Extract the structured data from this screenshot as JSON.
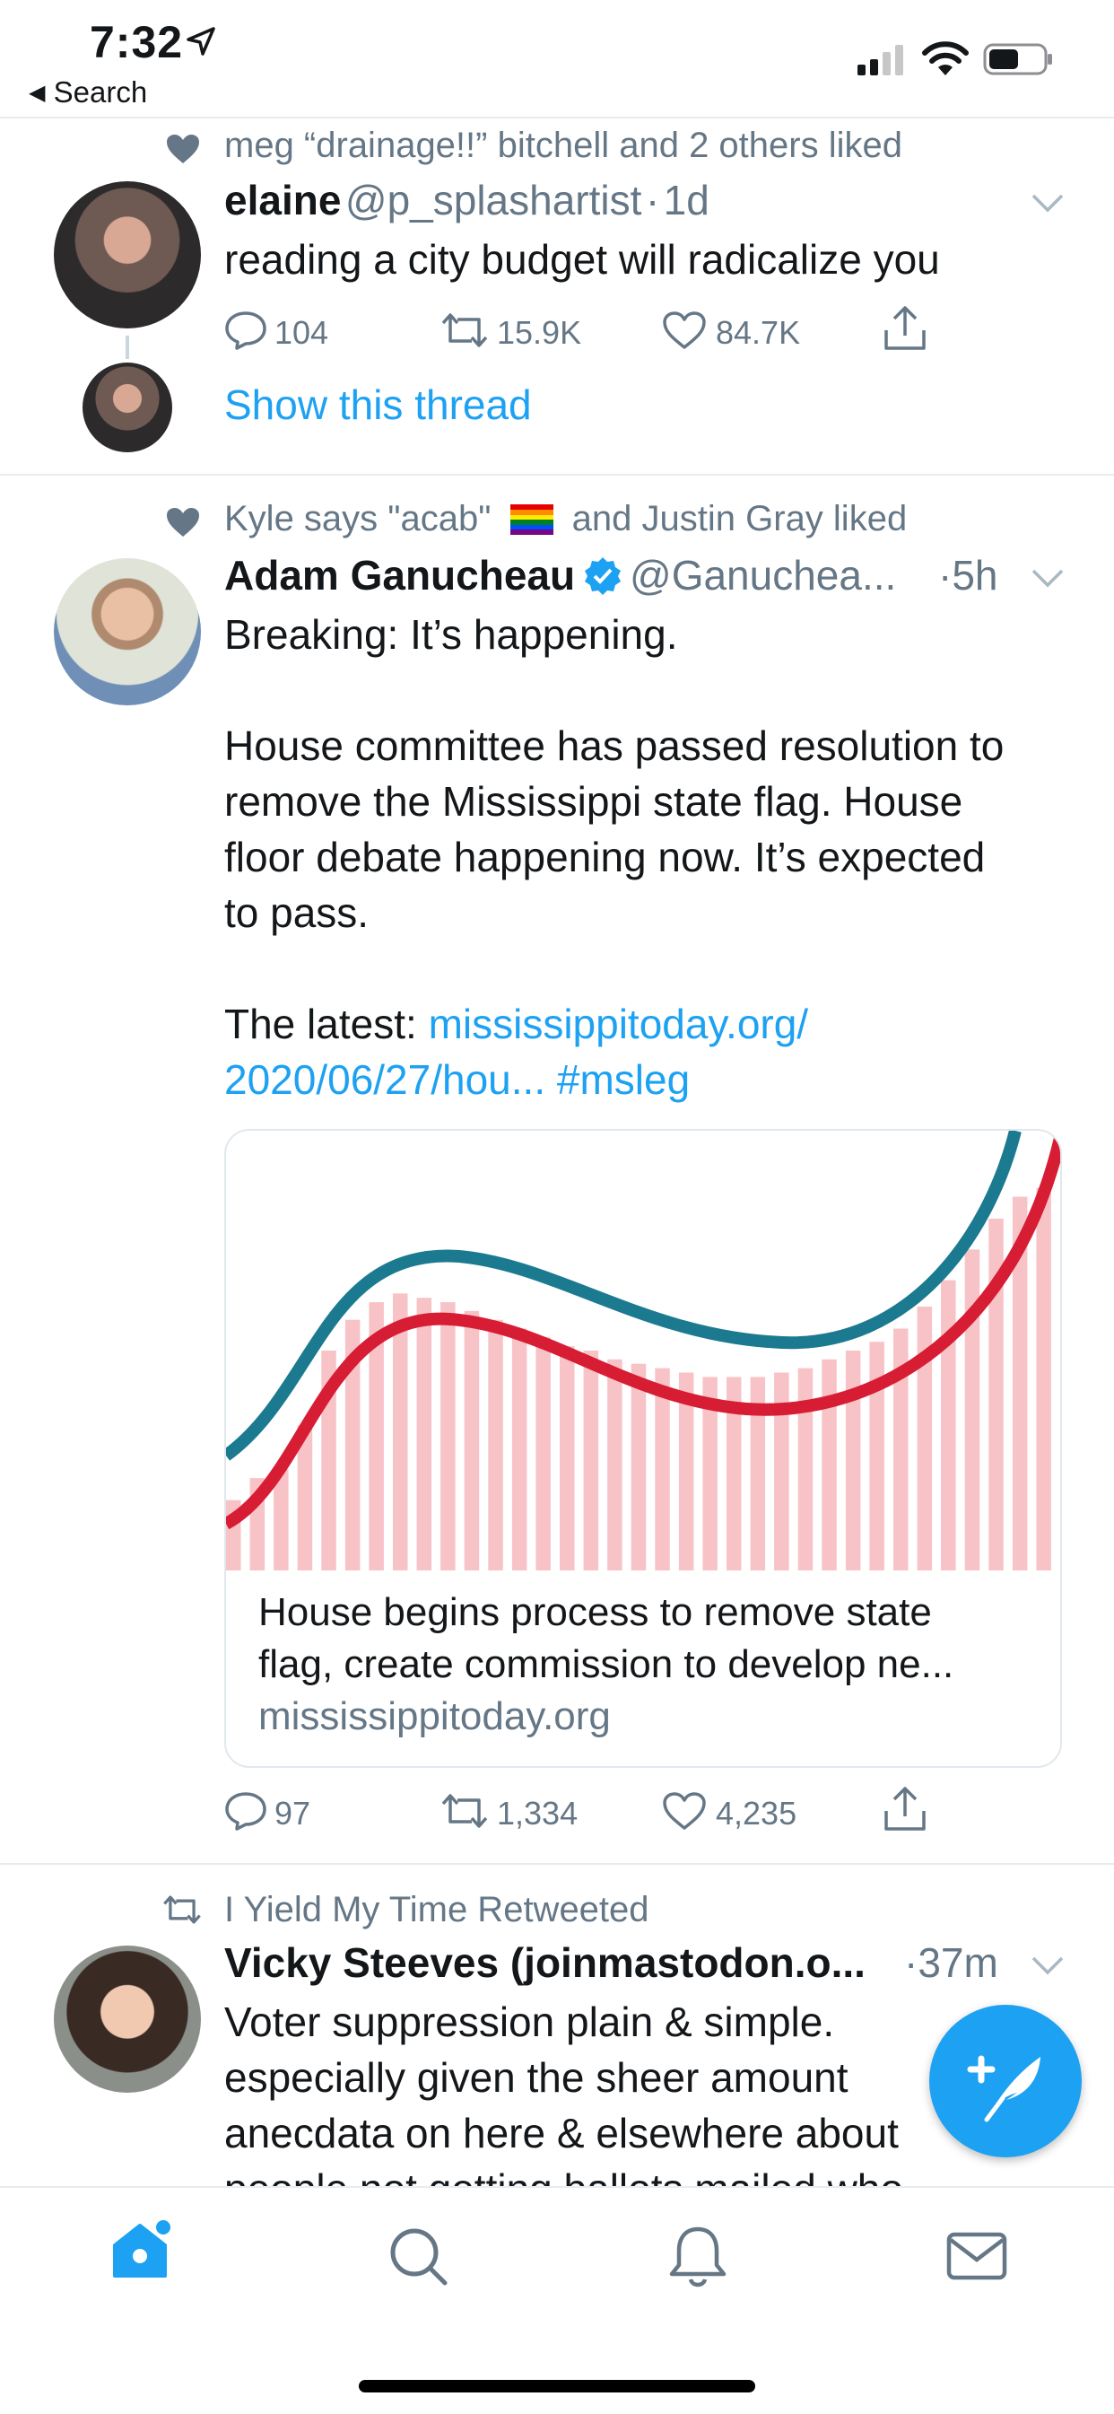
{
  "status_bar": {
    "time": "7:32",
    "back_label": "Search"
  },
  "tweets": [
    {
      "social_context": "meg “drainage!!” bitchell and 2 others liked",
      "name": "elaine",
      "handle": "@p_splashartist",
      "age": "1d",
      "text": "reading a city budget will radicalize you",
      "replies": "104",
      "retweets": "15.9K",
      "likes": "84.7K",
      "thread_link": "Show this thread"
    },
    {
      "social_context_a": "Kyle says \"acab\"",
      "social_context_b": "and Justin Gray liked",
      "name": "Adam Ganucheau",
      "handle": "@Ganuchea...",
      "age": "5h",
      "line1": "Breaking: It’s happening.",
      "para": [
        "House committee has passed resolution to",
        "remove the Mississippi state flag. House",
        "floor debate happening now. It’s expected",
        "to pass."
      ],
      "latest_prefix": "The latest:",
      "link1": "mississippitoday.org/",
      "link2": "2020/06/27/hou...",
      "hashtag": "#msleg",
      "card": {
        "title_line1": "House begins process to remove state",
        "title_line2": "flag, create commission to develop ne...",
        "domain": "mississippitoday.org"
      },
      "replies": "97",
      "retweets": "1,334",
      "likes": "4,235"
    },
    {
      "social_context": "I Yield My Time Retweeted",
      "name": "Vicky Steeves (joinmastodon.o...",
      "age": "37m",
      "lines": [
        "Voter suppression plain & simple.",
        "especially given the sheer amount",
        "anecdata on here & elsewhere about",
        "people not getting ballots mailed who"
      ]
    }
  ],
  "card_chart": {
    "bars": [
      16,
      21,
      23,
      33,
      50,
      57,
      61,
      63,
      62,
      61,
      59,
      57,
      55,
      53,
      51,
      50,
      48,
      47,
      46,
      45,
      44,
      44,
      44,
      45,
      46,
      48,
      50,
      52,
      55,
      60,
      66,
      73,
      80,
      85,
      87
    ]
  },
  "colors": {
    "accent": "#1da1f2",
    "teal": "#1b7a8f",
    "red": "#d71d34",
    "bar": "#f8c3c6"
  }
}
